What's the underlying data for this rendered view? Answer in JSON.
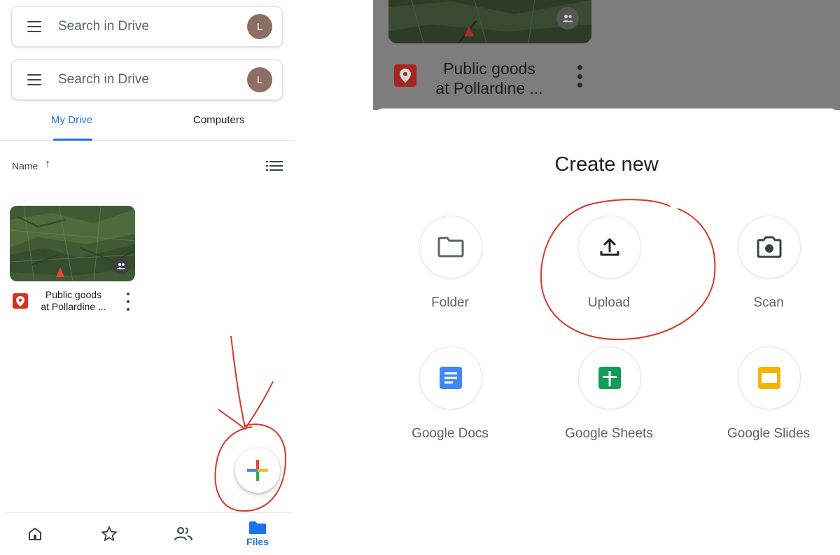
{
  "left": {
    "search_bars": [
      {
        "placeholder": "Search in Drive",
        "avatar_initial": "L"
      },
      {
        "placeholder": "Search in Drive",
        "avatar_initial": "L"
      }
    ],
    "tabs": [
      {
        "label": "My Drive",
        "active": true
      },
      {
        "label": "Computers",
        "active": false
      }
    ],
    "sort": {
      "label": "Name",
      "direction_glyph": "↑"
    },
    "files": [
      {
        "name_line1": "Public goods",
        "name_line2": "at Pollardine ...",
        "type_icon": "map-pin-icon",
        "shared": true
      }
    ],
    "fab_icon": "google-plus-icon",
    "bottom_nav": [
      {
        "icon": "home-icon",
        "label": ""
      },
      {
        "icon": "star-icon",
        "label": ""
      },
      {
        "icon": "shared-people-icon",
        "label": ""
      },
      {
        "icon": "folder-icon",
        "label": "Files",
        "active": true
      }
    ]
  },
  "right": {
    "background_file": {
      "name_line1": "Public goods",
      "name_line2": "at Pollardine ..."
    },
    "sheet_title": "Create new",
    "options": [
      {
        "label": "Folder",
        "icon": "folder-outline-icon"
      },
      {
        "label": "Upload",
        "icon": "upload-icon"
      },
      {
        "label": "Scan",
        "icon": "camera-icon"
      },
      {
        "label": "Google Docs",
        "icon": "google-docs-icon"
      },
      {
        "label": "Google Sheets",
        "icon": "google-sheets-icon"
      },
      {
        "label": "Google Slides",
        "icon": "google-slides-icon"
      }
    ]
  },
  "colors": {
    "accent_blue": "#1a73e8",
    "annotation_red": "#d9372b",
    "docs_blue": "#4285f4",
    "sheets_green": "#0f9d58",
    "slides_yellow": "#f4b400"
  }
}
